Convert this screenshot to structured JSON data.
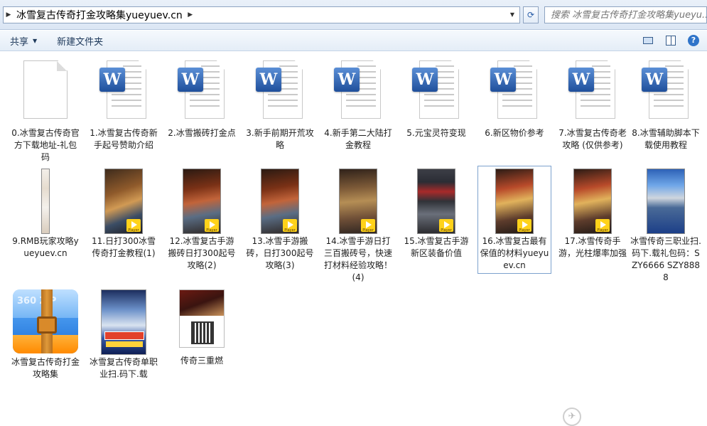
{
  "address": {
    "breadcrumb": "冰雪复古传奇打金攻略集yueyuev.cn",
    "search_placeholder": "搜索 冰雪复古传奇打金攻略集yueyu..."
  },
  "toolbar": {
    "share_label": "共享",
    "new_folder_label": "新建文件夹"
  },
  "files": [
    {
      "label": "0.冰雪复古传奇官方下载地址-礼包码",
      "kind": "blank"
    },
    {
      "label": "1.冰雪复古传奇新手起号赞助介绍",
      "kind": "word"
    },
    {
      "label": "2.冰雪搬砖打金点",
      "kind": "word"
    },
    {
      "label": "3.新手前期开荒攻略",
      "kind": "word"
    },
    {
      "label": "4.新手第二大陆打金教程",
      "kind": "word"
    },
    {
      "label": "5.元宝灵符变现",
      "kind": "word"
    },
    {
      "label": "6.新区物价参考",
      "kind": "word"
    },
    {
      "label": "7.冰雪复古传奇老攻略 (仅供参考)",
      "kind": "word"
    },
    {
      "label": "8.冰雪辅助脚本下载使用教程",
      "kind": "word"
    },
    {
      "label": "9.RMB玩家攻略yueyuev.cn",
      "kind": "image"
    },
    {
      "label": "11.日打300冰雪传奇打金教程(1)",
      "kind": "video"
    },
    {
      "label": "12.冰雪复古手游搬砖日打300起号攻略(2)",
      "kind": "video"
    },
    {
      "label": "13.冰雪手游搬砖，日打300起号攻略(3)",
      "kind": "video"
    },
    {
      "label": "14.冰雪手游日打三百搬砖号，快速打材料经验攻略！(4)",
      "kind": "video"
    },
    {
      "label": "15.冰雪复古手游新区装备价值",
      "kind": "video"
    },
    {
      "label": "16.冰雪复古最有保值的材料yueyuev.cn",
      "kind": "video"
    },
    {
      "label": "17.冰雪传奇手游，光柱爆率加强",
      "kind": "video"
    },
    {
      "label": "冰雪传奇三职业扫.码下.载礼包码：SZY6666 SZY8888",
      "kind": "image"
    },
    {
      "label": "冰雪复古传奇打金攻略集",
      "kind": "zip"
    },
    {
      "label": "冰雪复古传奇单职业扫.码下.载",
      "kind": "image"
    },
    {
      "label": "传奇三重燃",
      "kind": "image"
    }
  ],
  "player_badge": "Player",
  "zip_badge": "360 ZIP",
  "colors": {
    "accent": "#2f74c9",
    "selection_border": "#7da2ce"
  }
}
